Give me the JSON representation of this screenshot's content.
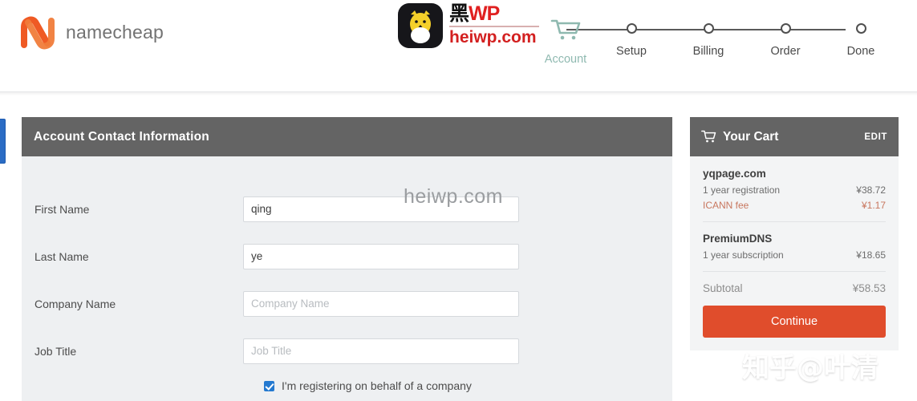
{
  "brand": {
    "name": "namecheap",
    "logo_icon": "namecheap-n-logo"
  },
  "stepper": {
    "steps": [
      {
        "label": "Account",
        "icon": "cart-icon",
        "active": true
      },
      {
        "label": "Setup",
        "icon": "step-dot",
        "active": false
      },
      {
        "label": "Billing",
        "icon": "step-dot",
        "active": false
      },
      {
        "label": "Order",
        "icon": "step-dot",
        "active": false
      },
      {
        "label": "Done",
        "icon": "step-dot",
        "active": false
      }
    ],
    "active_color": "#8fb9b0",
    "inactive_color": "#4a4a4a"
  },
  "watermarks": {
    "header_cn": "黑WP",
    "header_cn_char": "黑",
    "header_cn_wp": "WP",
    "header_domain": "heiwp.com",
    "center": "heiwp.com",
    "zhihu": "知乎@叶清",
    "owl_icon": "owl-logo-icon"
  },
  "form": {
    "header_title": "Account Contact Information",
    "fields": [
      {
        "label": "First Name",
        "value": "qing",
        "placeholder": "First Name"
      },
      {
        "label": "Last Name",
        "value": "ye",
        "placeholder": "Last Name"
      },
      {
        "label": "Company Name",
        "value": "",
        "placeholder": "Company Name"
      },
      {
        "label": "Job Title",
        "value": "",
        "placeholder": "Job Title"
      }
    ],
    "checkbox_label": "I'm registering on behalf of a company",
    "checkbox_checked": true
  },
  "cart": {
    "title": "Your Cart",
    "edit_label": "EDIT",
    "cart_icon": "shopping-cart-icon",
    "items": [
      {
        "name": "yqpage.com",
        "lines": [
          {
            "label": "1 year registration",
            "price": "¥38.72",
            "highlight": false
          },
          {
            "label": "ICANN fee",
            "price": "¥1.17",
            "highlight": true
          }
        ]
      },
      {
        "name": "PremiumDNS",
        "lines": [
          {
            "label": "1 year subscription",
            "price": "¥18.65",
            "highlight": false
          }
        ]
      }
    ],
    "subtotal_label": "Subtotal",
    "subtotal_value": "¥58.53",
    "continue_label": "Continue",
    "accent_color": "#e04d2c",
    "fee_color": "#c8775f"
  }
}
